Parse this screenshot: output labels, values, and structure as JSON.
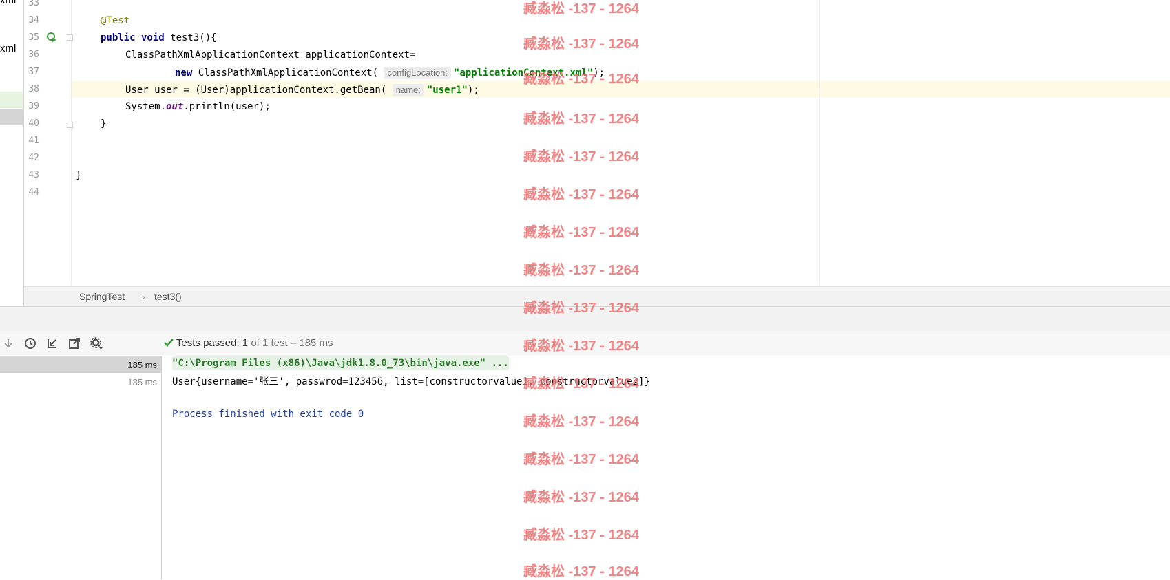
{
  "project_panel": {
    "clipped_top": "xml",
    "clipped_label": "xml"
  },
  "editor": {
    "line_numbers": [
      "33",
      "34",
      "35",
      "36",
      "37",
      "38",
      "39",
      "40",
      "41",
      "42",
      "43",
      "44"
    ],
    "code": {
      "l34_annotation": "@Test",
      "l35_kw": "public void",
      "l35_rest": " test3(){",
      "l36": "ClassPathXmlApplicationContext applicationContext=",
      "l37_kw": "new",
      "l37_class": " ClassPathXmlApplicationContext(",
      "l37_hint": "configLocation:",
      "l37_str": "\"applicationContext.xml\"",
      "l37_end": ");",
      "l38_start": "User user = (User)applicationContext.getBean(",
      "l38_hint": "name:",
      "l38_str": "\"user1\"",
      "l38_end": ");",
      "l39_start": "System.",
      "l39_field": "out",
      "l39_end": ".println(user);",
      "l40": "}",
      "l43": "}"
    }
  },
  "breadcrumb": {
    "class_name": "SpringTest",
    "separator": "›",
    "method_name": "test3()"
  },
  "test_runner": {
    "status_prefix": "Tests passed:",
    "status_count": "1",
    "status_suffix": "of 1 test – 185 ms",
    "tree": [
      {
        "time": "185 ms"
      },
      {
        "time": "185 ms"
      }
    ]
  },
  "console": {
    "command": "\"C:\\Program Files (x86)\\Java\\jdk1.8.0_73\\bin\\java.exe\" ...",
    "output": "User{username='张三', passwrod=123456, list=[constructorvalue1, constructorvalue2]}",
    "exit": "Process finished with exit code 0"
  },
  "watermark": {
    "text": "臧淼松 -137 - 1264"
  },
  "colors": {
    "caret_row": "#fffae3",
    "watermark": "#ef6f6f",
    "pass_green": "#3c9a3c",
    "string": "#008000",
    "keyword": "#000080"
  }
}
